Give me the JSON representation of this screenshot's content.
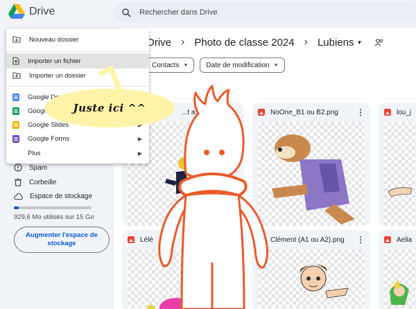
{
  "header": {
    "app_name": "Drive",
    "search_placeholder": "Rechercher dans Drive"
  },
  "breadcrumb": {
    "items": [
      "Drive",
      "Photo de classe 2024",
      "Lubiens"
    ]
  },
  "filters": {
    "chips": [
      "Contacts",
      "Date de modification"
    ]
  },
  "menu": {
    "items": [
      {
        "label": "Nouveau dossier",
        "icon": "new-folder-icon"
      },
      {
        "label": "Importer un fichier",
        "icon": "file-upload-icon"
      },
      {
        "label": "Importer un dossier",
        "icon": "folder-upload-icon"
      },
      {
        "label": "Google Docs",
        "icon": "google-docs-icon",
        "color": "#4285f4"
      },
      {
        "label": "Google Sheets",
        "icon": "google-sheets-icon",
        "color": "#0f9d58"
      },
      {
        "label": "Google Slides",
        "icon": "google-slides-icon",
        "color": "#f4b400"
      },
      {
        "label": "Google Forms",
        "icon": "google-forms-icon",
        "color": "#7248b9"
      },
      {
        "label": "Plus",
        "icon": ""
      }
    ]
  },
  "sidebar": {
    "items": [
      {
        "label": "Spam",
        "icon": "spam-icon"
      },
      {
        "label": "Corbeille",
        "icon": "trash-icon"
      },
      {
        "label": "Espace de stockage",
        "icon": "cloud-icon"
      }
    ],
    "storage_used_fraction": 0.06,
    "storage_text": "929,6 Mo utilisés sur 15 Go",
    "upgrade_label": "Augmenter l'espace de stockage"
  },
  "files": [
    {
      "name": "...t a1.png"
    },
    {
      "name": "NoOne_B1 ou B2.png"
    },
    {
      "name": "lou_j"
    },
    {
      "name": "Lélé"
    },
    {
      "name": "Clément (A1 ou A2).png"
    },
    {
      "name": "Aelia"
    }
  ],
  "annotation": {
    "text": "Juste ici ^^"
  },
  "colors": {
    "accent": "#0b57d0",
    "annotation_bg": "#fff3a8",
    "drawing_stroke": "#e85a2a"
  }
}
